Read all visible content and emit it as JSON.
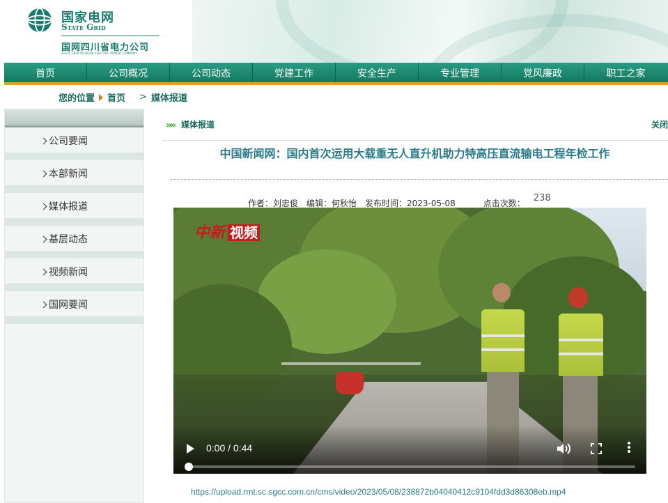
{
  "header": {
    "logo_cn": "国家电网",
    "logo_en": "State Grid",
    "company_cn": "国网四川省电力公司",
    "company_en": "STATE GRID SICHUAN ELECTRIC POWER COMPANY"
  },
  "nav": {
    "items": [
      "首页",
      "公司概况",
      "公司动态",
      "党建工作",
      "安全生产",
      "专业管理",
      "党风廉政",
      "职工之家"
    ]
  },
  "breadcrumb": {
    "label": "您的位置",
    "home": "首页",
    "current": "媒体报道"
  },
  "sidebar": {
    "items": [
      "公司要闻",
      "本部新闻",
      "媒体报道",
      "基层动态",
      "视频新闻",
      "国网要闻"
    ]
  },
  "content": {
    "section_label": "媒体报道",
    "close_label": "关闭",
    "title": "中国新闻网：国内首次运用大载重无人直升机助力特高压直流输电工程年检工作",
    "meta": {
      "author": "作者：刘忠俊",
      "editor": "编辑：何秋怡",
      "published": "发布时间：2023-05-08",
      "views_label": "点击次数：",
      "views": "238"
    }
  },
  "video": {
    "watermark_italic": "中新",
    "watermark_box": "视频",
    "time": "0:00 / 0:44",
    "progress": 0,
    "url": "https://upload.rmt.sc.sgcc.com.cn/cms/video/2023/05/08/238872b04040412c9104fdd3d86308eb.mp4"
  },
  "colors": {
    "brand_green": "#1a7a6e",
    "nav_green": "#12795f",
    "nav_accent": "#e0a130",
    "title_blue": "#2a7a8c"
  },
  "icons": {
    "logo": "state-grid-globe-icon",
    "play": "play-icon",
    "volume": "volume-icon",
    "fullscreen": "fullscreen-icon",
    "more": "more-vertical-icon"
  }
}
